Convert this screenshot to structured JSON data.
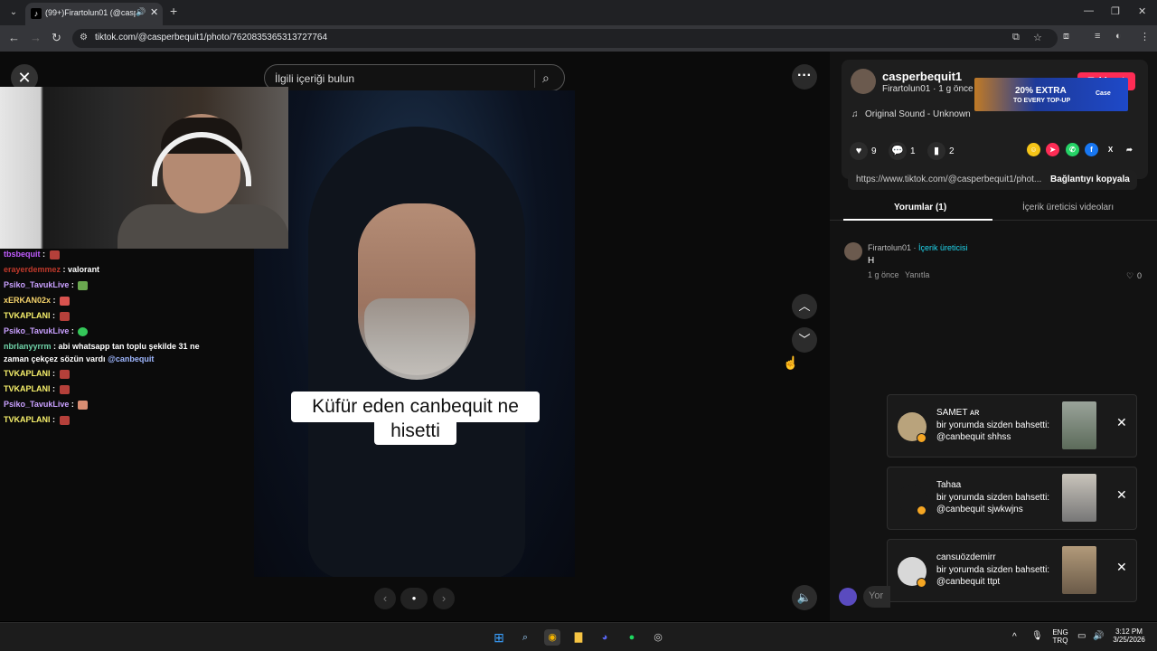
{
  "browser": {
    "tab_title": "(99+)Firartolun01 (@caspe",
    "tab_audio_icon": "speaker-icon",
    "url": "tiktok.com/@casperbequit1/photo/7620835365313727764",
    "window_controls": [
      "minimize",
      "restore",
      "close"
    ]
  },
  "viewer": {
    "search_placeholder": "İlgili içeriği bulun",
    "caption_line1": "Küfür eden canbequit ne",
    "caption_line2": "hisetti"
  },
  "chat": [
    {
      "user": "tbsbequit",
      "user_color": "#c15cff",
      "text": "",
      "emote": "#b5403a"
    },
    {
      "user": "erayerdemmez",
      "user_color": "#c0392b",
      "text": "valorant",
      "emote": null
    },
    {
      "user": "Psiko_TavukLive",
      "user_color": "#c9a0ff",
      "text": "",
      "emote": "#6aa84f"
    },
    {
      "user": "xERKAN02x",
      "user_color": "#f5d36b",
      "text": "",
      "emote": "#d9534f"
    },
    {
      "user": "TVKAPLANI",
      "user_color": "#f7f06b",
      "text": "",
      "emote": "#b5403a"
    },
    {
      "user": "Psiko_TavukLive",
      "user_color": "#c9a0ff",
      "text": "",
      "emote": "#34c759"
    },
    {
      "user": "nbrlanyyrrm",
      "user_color": "#6fd3a8",
      "text": "abi whatsapp tan toplu şekilde 31 ne",
      "emote": null
    },
    {
      "user": "",
      "user_color": "#fff",
      "text": "zaman çekçez sözün vardı",
      "mention": "@canbequit",
      "emote": null
    },
    {
      "user": "TVKAPLANI",
      "user_color": "#f7f06b",
      "text": "",
      "emote": "#b5403a"
    },
    {
      "user": "TVKAPLANI",
      "user_color": "#f7f06b",
      "text": "",
      "emote": "#b5403a"
    },
    {
      "user": "Psiko_TavukLive",
      "user_color": "#c9a0ff",
      "text": "",
      "emote": "#d98e73"
    },
    {
      "user": "TVKAPLANI",
      "user_color": "#f7f06b",
      "text": "",
      "emote": "#b5403a"
    }
  ],
  "post": {
    "username": "casperbequit1",
    "subline": "Firartolun01 · 1 g önce",
    "sound": "Original Sound - Unknown",
    "follow_label": "Takip et",
    "ad_text": "20% EXTRA",
    "ad_sub": "TO EVERY TOP-UP",
    "ad_brand": "Case",
    "likes": "9",
    "comments": "1",
    "saves": "2",
    "link": "https://www.tiktok.com/@casperbequit1/phot...",
    "copy_label": "Bağlantıyı kopyala",
    "tab_comments": "Yorumlar (1)",
    "tab_creator": "İçerik üreticisi videoları"
  },
  "comment": {
    "author": "Firartolun01",
    "badge": "İçerik üreticisi",
    "text": "H",
    "time": "1 g önce",
    "reply": "Yanıtla",
    "likes": "0"
  },
  "notifications": [
    {
      "name": "SAMET ᴀʀ",
      "line1": "bir yorumda sizden bahsetti:",
      "line2": "@canbequit shhss"
    },
    {
      "name": "Tahaa",
      "line1": "bir yorumda sizden bahsetti:",
      "line2": "@canbequit sjwkwjns"
    },
    {
      "name": "cansuözdemirr",
      "line1": "bir yorumda sizden bahsetti:",
      "line2": "@canbequit ttpt"
    }
  ],
  "comment_input_placeholder": "Yor",
  "taskbar": {
    "lang_top": "ENG",
    "lang_bottom": "TRQ",
    "time": "3:12 PM",
    "date": "3/25/2026"
  },
  "colors": {
    "accent": "#fe2c55",
    "creator_badge": "#20d5ec"
  }
}
